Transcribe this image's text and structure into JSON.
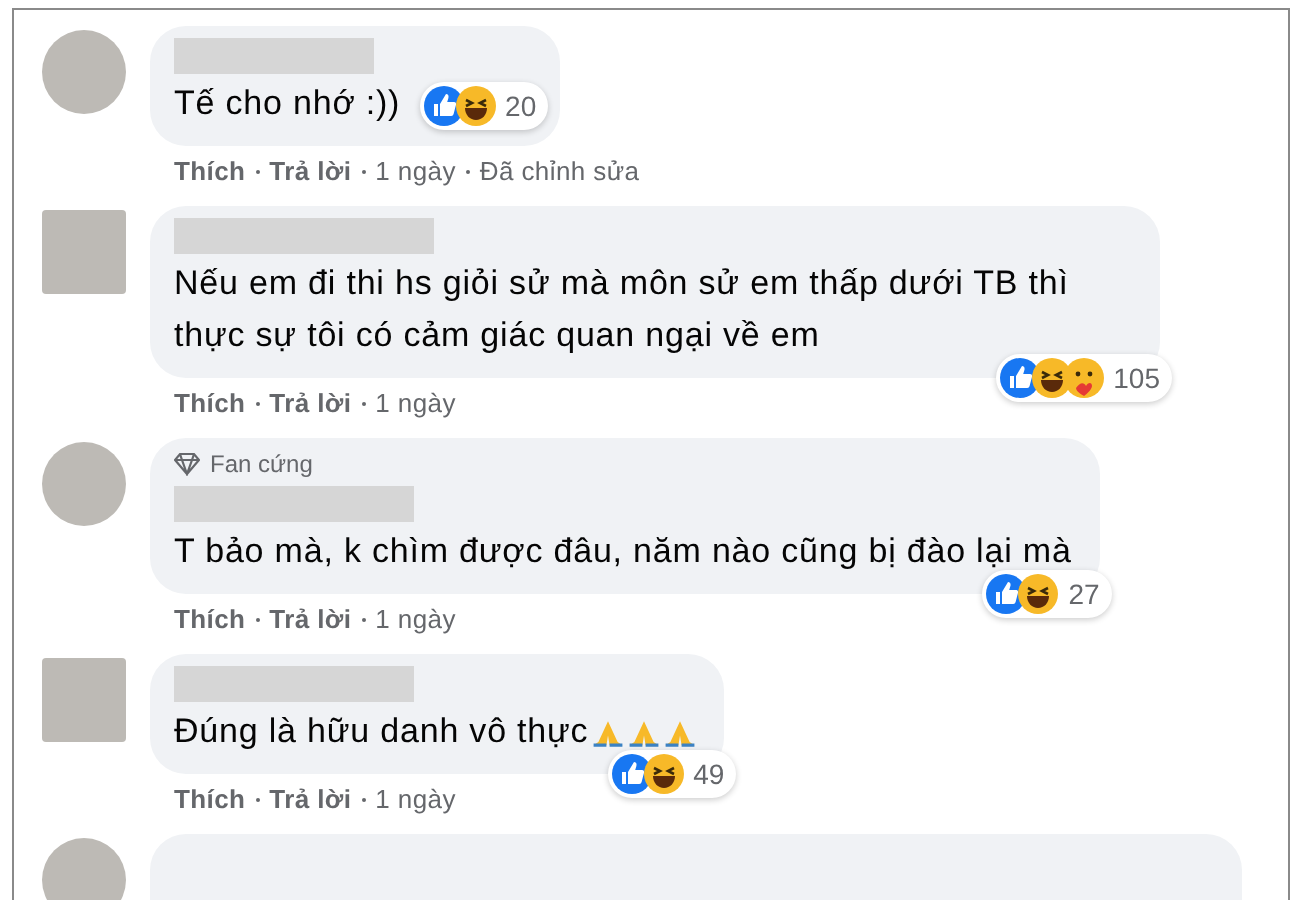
{
  "comments": [
    {
      "text": "Tế cho nhớ :))",
      "reactions_inline": true,
      "reactions": [
        {
          "kind": "like"
        },
        {
          "kind": "haha"
        }
      ],
      "reaction_count": "20",
      "actions": [
        {
          "label": "Thích",
          "kind": "link"
        },
        {
          "label": "Trả lời",
          "kind": "link"
        },
        {
          "label": "1 ngày",
          "kind": "meta"
        },
        {
          "label": "Đã chỉnh sửa",
          "kind": "meta"
        }
      ]
    },
    {
      "text": "Nếu em đi thi hs giỏi sử mà môn sử em thấp dưới TB thì thực sự tôi có cảm giác quan ngại về em",
      "reactions_inline": false,
      "reactions": [
        {
          "kind": "like"
        },
        {
          "kind": "haha"
        },
        {
          "kind": "care"
        }
      ],
      "reaction_count": "105",
      "actions": [
        {
          "label": "Thích",
          "kind": "link"
        },
        {
          "label": "Trả lời",
          "kind": "link"
        },
        {
          "label": "1 ngày",
          "kind": "meta"
        }
      ]
    },
    {
      "badge": "Fan cứng",
      "text": "T bảo mà, k chìm được đâu, năm nào cũng bị đào lại mà",
      "reactions_inline": false,
      "reactions": [
        {
          "kind": "like"
        },
        {
          "kind": "haha"
        }
      ],
      "reaction_count": "27",
      "actions": [
        {
          "label": "Thích",
          "kind": "link"
        },
        {
          "label": "Trả lời",
          "kind": "link"
        },
        {
          "label": "1 ngày",
          "kind": "meta"
        }
      ]
    },
    {
      "text": "Đúng là hữu danh vô thực",
      "emojis": [
        {
          "kind": "pray"
        },
        {
          "kind": "pray"
        },
        {
          "kind": "pray"
        }
      ],
      "reactions_inline": false,
      "reactions": [
        {
          "kind": "like"
        },
        {
          "kind": "haha"
        }
      ],
      "reaction_count": "49",
      "actions": [
        {
          "label": "Thích",
          "kind": "link"
        },
        {
          "label": "Trả lời",
          "kind": "link"
        },
        {
          "label": "1 ngày",
          "kind": "meta"
        }
      ]
    }
  ]
}
